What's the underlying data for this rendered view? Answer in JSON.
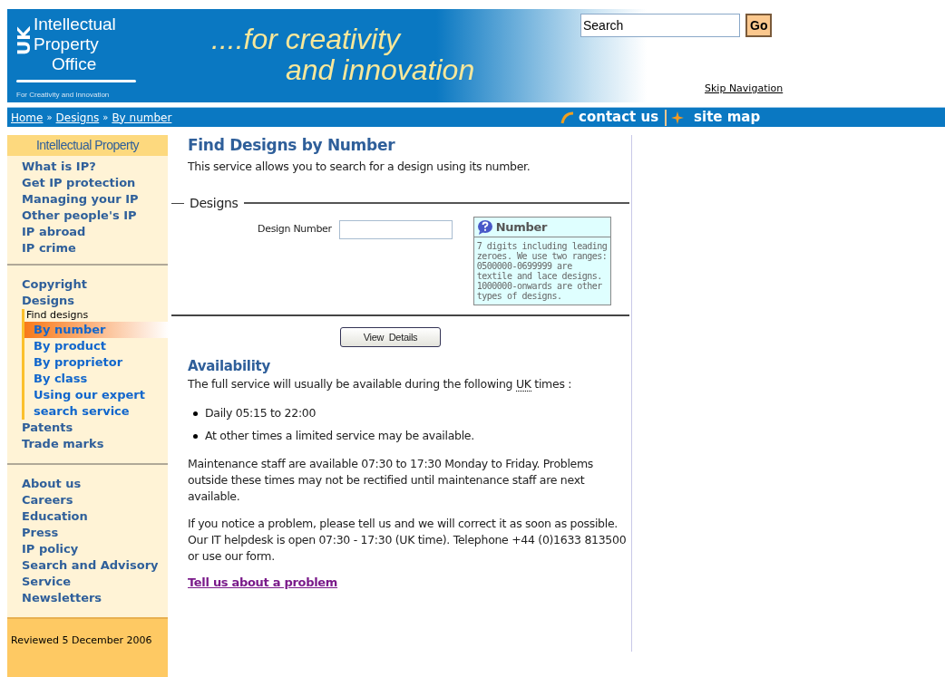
{
  "header": {
    "logo_mark": "UK",
    "logo_lines": [
      "Intellectual",
      "Property",
      "Office"
    ],
    "logo_tagline": "For Creativity and Innovation",
    "slogan": [
      "....for creativity",
      "and innovation"
    ],
    "search": {
      "value": "Search",
      "button": "Go"
    },
    "skip_link": "Skip Navigation"
  },
  "nav_bar": {
    "breadcrumbs": [
      "Home",
      "Designs",
      "By number"
    ],
    "separator": "»",
    "links": [
      "contact us",
      "site map"
    ]
  },
  "sidebar": {
    "heading": "Intellectual Property",
    "groups": [
      {
        "items": [
          {
            "label": "What is IP?"
          },
          {
            "label": "Get IP protection"
          },
          {
            "label": "Managing your IP"
          },
          {
            "label": "Other people's IP"
          },
          {
            "label": "IP abroad"
          },
          {
            "label": "IP crime"
          }
        ]
      },
      {
        "items": [
          {
            "label": "Copyright"
          },
          {
            "label": "Designs",
            "submenu_label": "Find designs",
            "children": [
              {
                "label": "By number",
                "selected": true
              },
              {
                "label": "By product",
                "selected": false
              },
              {
                "label": "By proprietor",
                "selected": false
              },
              {
                "label": "By class",
                "selected": false
              },
              {
                "label": "Using our expert search service",
                "selected": false
              }
            ]
          },
          {
            "label": "Patents"
          },
          {
            "label": "Trade marks"
          }
        ]
      },
      {
        "items": [
          {
            "label": "About us"
          },
          {
            "label": "Careers"
          },
          {
            "label": "Education"
          },
          {
            "label": "Press"
          },
          {
            "label": "IP policy"
          },
          {
            "label": "Search and Advisory Service"
          },
          {
            "label": "Newsletters"
          }
        ]
      }
    ],
    "reviewed": "Reviewed 5 December 2006"
  },
  "main": {
    "title": "Find Designs by Number",
    "intro": "This service allows you to search for a design using its number.",
    "fieldset": {
      "legend": "Designs",
      "field_label": "Design Number",
      "help": {
        "title": "Number",
        "text": "7 digits including leading zeroes. We use two ranges: 0500000-0699999 are textile and lace designs. 1000000-onwards are other types of designs."
      }
    },
    "button": "View  Details",
    "availability": {
      "heading": "Availability",
      "lead": {
        "before": "The full service will usually be available during the following ",
        "abbr": "UK",
        "after": " times :"
      },
      "bullets": [
        "Daily 05:15 to 22:00",
        "At other times a limited service may be available."
      ],
      "paragraphs": [
        "Maintenance staff are available 07:30 to 17:30 Monday to Friday. Problems outside these times may not be rectified until maintenance staff are next available.",
        "If you notice a problem, please tell us and we will correct it as soon as possible. Our IT helpdesk is open 07:30 - 17:30 (UK time). Telephone +44 (0)1633 813500 or use our form."
      ],
      "link": "Tell us about a problem"
    }
  }
}
